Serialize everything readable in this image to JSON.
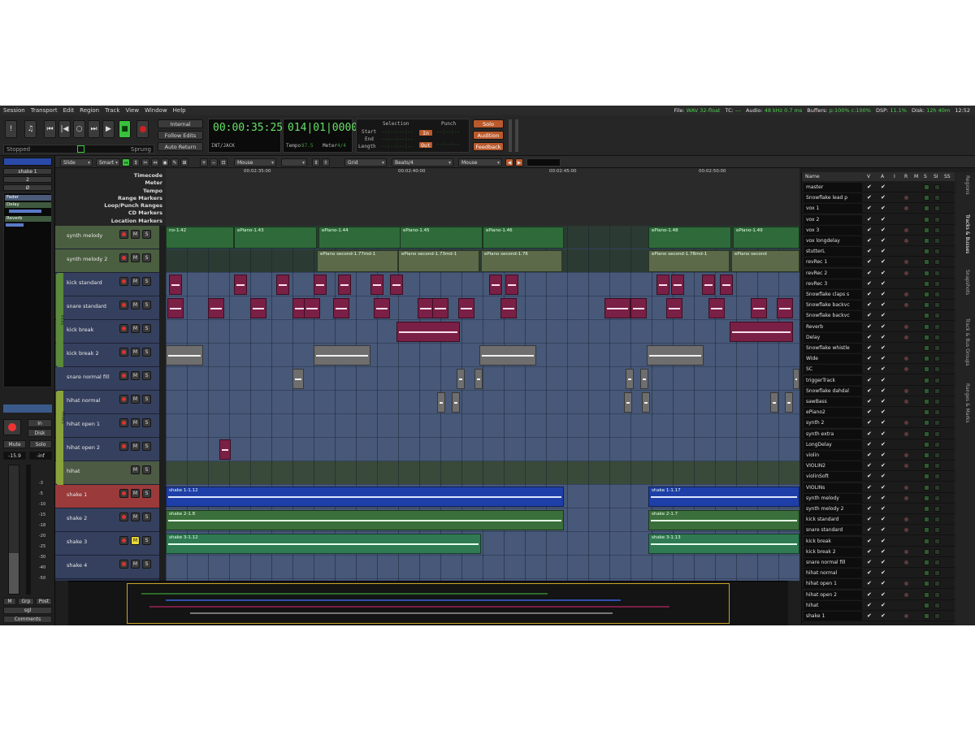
{
  "menu": [
    "Session",
    "Transport",
    "Edit",
    "Region",
    "Track",
    "View",
    "Window",
    "Help"
  ],
  "status": {
    "file_label": "File:",
    "file_value": "WAV 32-float",
    "tc_label": "TC:",
    "tc_value": "---",
    "audio_label": "Audio:",
    "audio_value": "48 kHz 0.7 ms",
    "buffers_label": "Buffers:",
    "buffers_value": "p:100% c:100%",
    "dsp_label": "DSP:",
    "dsp_value": "11.1%",
    "disk_label": "Disk:",
    "disk_value": "12h 40m",
    "time": "12:52"
  },
  "transport": {
    "sync_label": "Internal",
    "follow_edits": "Follow Edits",
    "auto_return": "Auto Return",
    "clock_primary": "00:00:35:25",
    "clock_primary_sub": "INT/JACK",
    "clock_secondary": "014|01|0000",
    "tempo_label": "Tempo",
    "tempo_value": "87.5",
    "meter_label": "Meter",
    "meter_value": "4/4",
    "status_text": "Stopped",
    "sprung": "Sprung"
  },
  "selection": {
    "title": "Selection",
    "start_label": "Start",
    "end_label": "End",
    "length_label": "Length",
    "punch_title": "Punch",
    "in_label": "In",
    "out_label": "Out",
    "solo": "Solo",
    "audition": "Audition",
    "feedback": "Feedback"
  },
  "edit_toolbar": {
    "edit_mode": "Slide",
    "tool_mode": "Smart",
    "zoom_focus": "Mouse",
    "grid_type": "Grid",
    "grid_value": "Beats/4",
    "snap_point": "Mouse"
  },
  "rulers": [
    "Timecode",
    "Meter",
    "Tempo",
    "Range Markers",
    "Loop/Punch Ranges",
    "CD Markers",
    "Location Markers"
  ],
  "timecode_ticks": [
    "00:02:35:00",
    "00:02:40:00",
    "00:02:45:00",
    "00:02:50:00"
  ],
  "mixer_strip": {
    "track_name": "shake 1",
    "input": "2",
    "phase": "Ø",
    "plugins": [
      "Fader",
      "Delay",
      "Reverb"
    ],
    "in_btn": "In",
    "disk_btn": "Disk",
    "mute": "Mute",
    "solo": "Solo",
    "gain_value": "-15.9",
    "peak_value": "-inf",
    "meter_ticks": [
      "-3",
      "-5",
      "-10",
      "-15",
      "-18",
      "-20",
      "-25",
      "-30",
      "-40",
      "-50"
    ],
    "m_btn": "M",
    "grp_btn": "Grp",
    "post_btn": "Post",
    "sgl": "sgl",
    "comments": "Comments"
  },
  "tracks": [
    {
      "name": "synth melody",
      "kind": "midi",
      "muted": false
    },
    {
      "name": "synth melody 2",
      "kind": "midi",
      "muted": false
    },
    {
      "name": "kick standard",
      "kind": "audio",
      "muted": false
    },
    {
      "name": "snare standard",
      "kind": "audio",
      "muted": false
    },
    {
      "name": "kick break",
      "kind": "audio",
      "muted": false
    },
    {
      "name": "kick break 2",
      "kind": "audio",
      "muted": false
    },
    {
      "name": "snare normal fill",
      "kind": "audio",
      "muted": false
    },
    {
      "name": "hihat normal",
      "kind": "audio",
      "muted": false
    },
    {
      "name": "hihat open 1",
      "kind": "audio",
      "muted": false
    },
    {
      "name": "hihat open 2",
      "kind": "audio",
      "muted": false
    },
    {
      "name": "hihat",
      "kind": "bus",
      "muted": false
    },
    {
      "name": "shake 1",
      "kind": "audio",
      "muted": false
    },
    {
      "name": "shake 2",
      "kind": "audio",
      "muted": false
    },
    {
      "name": "shake 3",
      "kind": "audio",
      "muted": true
    },
    {
      "name": "shake 4",
      "kind": "audio",
      "muted": false
    }
  ],
  "group_tabs": [
    "kicks",
    "hihats"
  ],
  "regions": {
    "synth_melody": [
      "no-1.42",
      "ePiano-1.43",
      "ePiano-1.44",
      "ePiano-1.45",
      "ePiano-1.46",
      "ePiano-1.48",
      "ePiano-1.49"
    ],
    "synth_melody_2": [
      "ePiano second-1.77md-1",
      "ePiano second-1.73md-1",
      "ePiano second-1.76",
      "ePiano second-1.78md-1",
      "ePiano second"
    ],
    "shake": [
      "shake 1-1.12",
      "shake 1-1.17",
      "shake 2-1.8",
      "shake 2-1.7",
      "shake 3-1.12",
      "shake 3-1.13"
    ]
  },
  "tracklist_header": [
    "Name",
    "V",
    "A",
    "I",
    "R",
    "M",
    "S",
    "SI",
    "SS"
  ],
  "tracklist": [
    "master",
    "Snowflake lead p",
    "vox 1",
    "vox 2",
    "vox 3",
    "vox longdelay",
    "stutterL",
    "revRec 1",
    "revRec 2",
    "revRec 3",
    "Snowflake claps s",
    "Snowflake backvc",
    "Snowflake backvc",
    "Reverb",
    "Delay",
    "Snowflake whistle",
    "Wide",
    "SC",
    "triggerTrack",
    "Snowflake dahdal",
    "sawBass",
    "ePiano2",
    "synth 2",
    "synth extra",
    "LongDelay",
    "violin",
    "VIOLIN2",
    "violinSoft",
    "VIOLINs",
    "synth melody",
    "synth melody 2",
    "kick standard",
    "snare standard",
    "kick break",
    "kick break 2",
    "snare normal fill",
    "hihat normal",
    "hihat open 1",
    "hihat open 2",
    "hihat",
    "shake 1"
  ],
  "side_tabs": [
    "Regions",
    "Tracks & Busses",
    "Snapshots",
    "Track & Bus Groups",
    "Ranges & Marks"
  ],
  "colors": {
    "accent_green": "#39c03c",
    "record_red": "#cc2222",
    "midi_region": "#2f6b3a",
    "kick_region": "#7a1f45",
    "shake_region": "#1f3fa8",
    "canvas_bg": "#475878"
  }
}
